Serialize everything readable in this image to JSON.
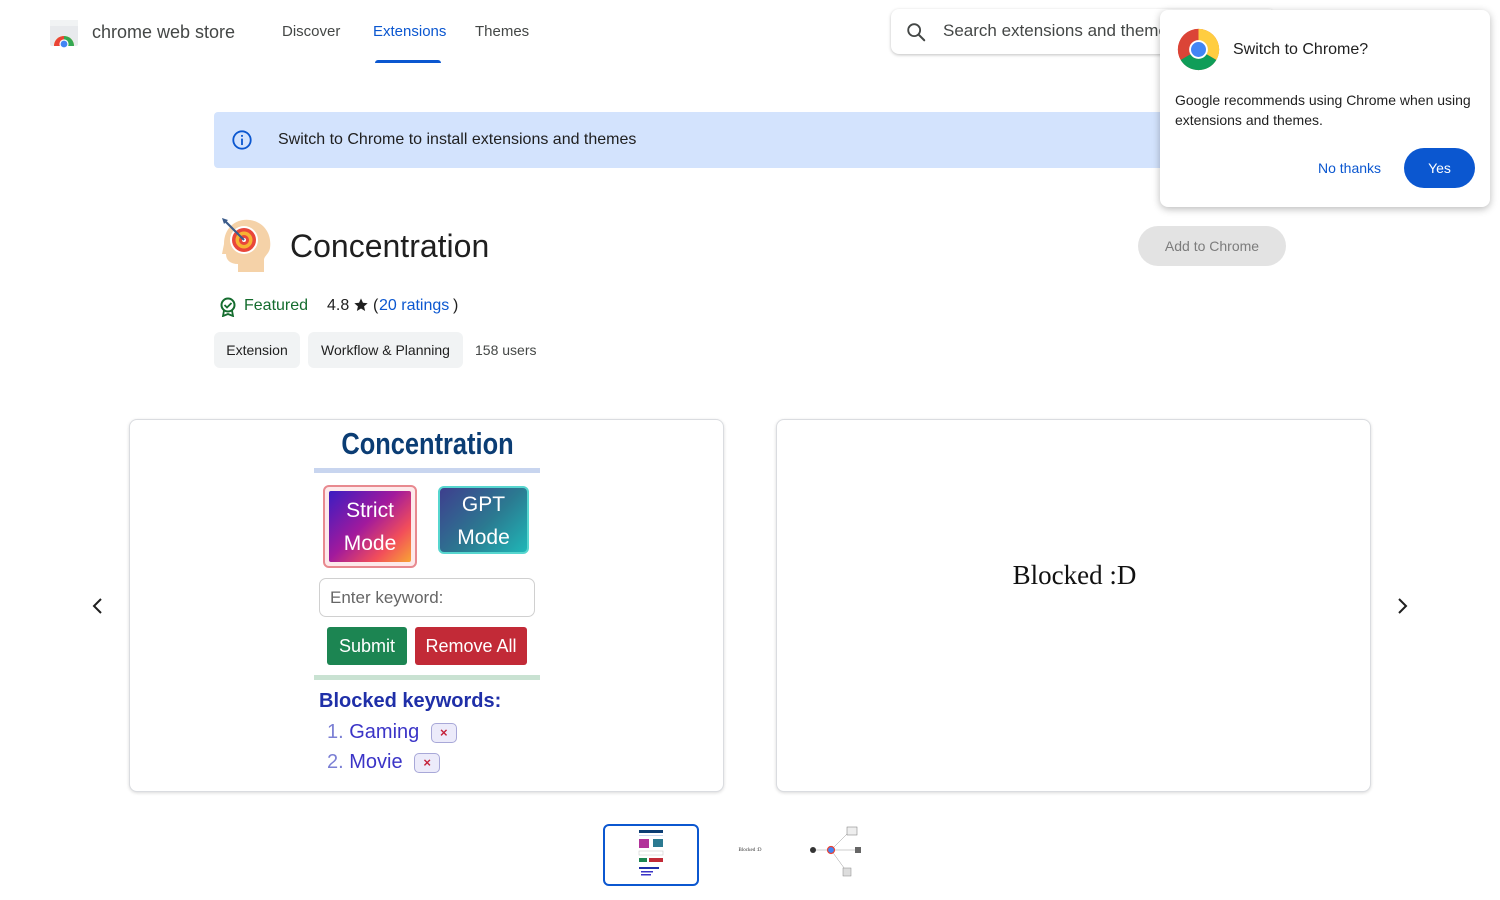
{
  "header": {
    "brand": "chrome web store",
    "nav": {
      "discover": "Discover",
      "extensions": "Extensions",
      "themes": "Themes"
    },
    "active_nav": "Extensions",
    "search_placeholder": "Search extensions and themes"
  },
  "banner": {
    "text": "Switch to Chrome to install extensions and themes"
  },
  "extension": {
    "title": "Concentration",
    "add_button": "Add to Chrome",
    "featured_label": "Featured",
    "rating": "4.8",
    "ratings_open": "(",
    "ratings_link": "20 ratings",
    "ratings_close": ")",
    "chips": {
      "type": "Extension",
      "category": "Workflow & Planning"
    },
    "users": "158 users"
  },
  "carousel": {
    "slide1": {
      "title": "Concentration",
      "strict_mode_line1": "Strict",
      "strict_mode_line2": "Mode",
      "gpt_mode_line1": "GPT",
      "gpt_mode_line2": "Mode",
      "input_placeholder": "Enter keyword:",
      "submit": "Submit",
      "remove_all": "Remove All",
      "blocked_heading": "Blocked keywords:",
      "keywords": [
        {
          "num": "1.",
          "word": "Gaming",
          "remove": "×"
        },
        {
          "num": "2.",
          "word": "Movie",
          "remove": "×"
        }
      ]
    },
    "slide2": {
      "text": "Blocked :D"
    },
    "thumbnail_count": 3,
    "selected_thumbnail": 1
  },
  "popup": {
    "title": "Switch to Chrome?",
    "body": "Google recommends using Chrome when using extensions and themes.",
    "no_button": "No thanks",
    "yes_button": "Yes"
  },
  "colors": {
    "accent": "#0b57d0",
    "banner_bg": "#d3e3fd",
    "featured": "#146c2e",
    "disabled_button": "#e3e3e3"
  },
  "icons": [
    "chrome-web-store-logo",
    "search-icon",
    "info-icon",
    "concentration-app-icon",
    "featured-badge-icon",
    "star-icon",
    "chevron-left-icon",
    "chevron-right-icon",
    "chrome-logo"
  ]
}
